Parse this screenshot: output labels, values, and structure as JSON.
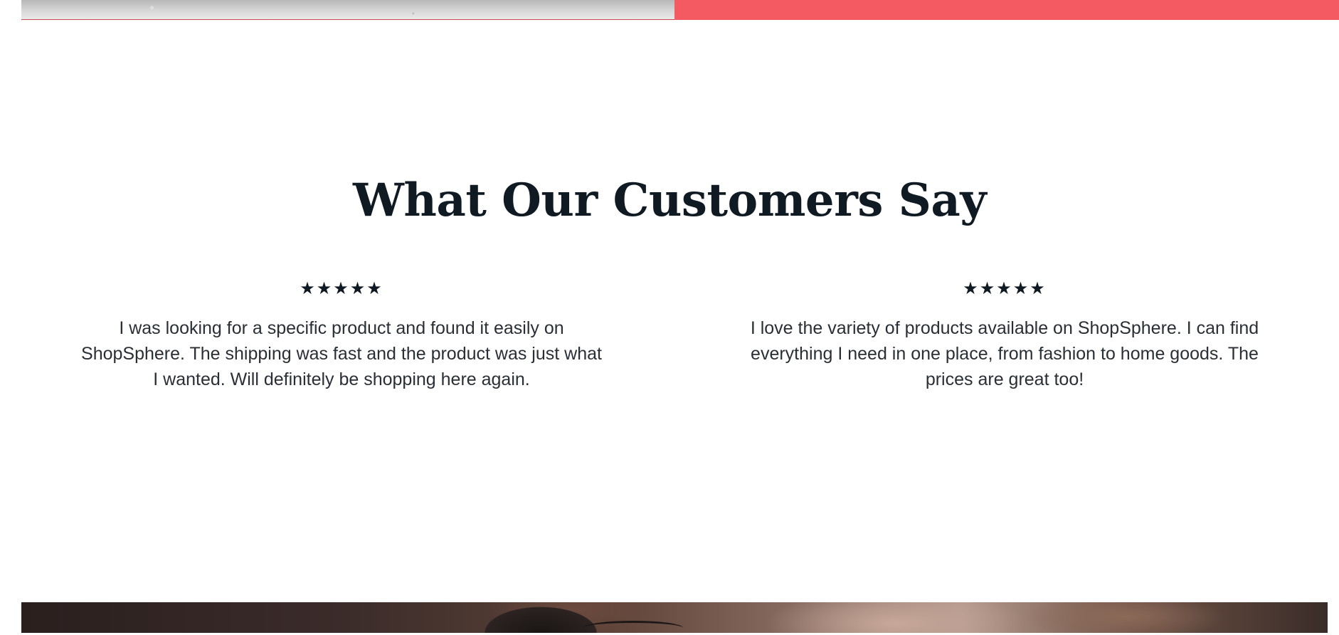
{
  "testimonials": {
    "title": "What Our Customers Say",
    "reviews": [
      {
        "rating": 5,
        "stars": "★★★★★",
        "text": "I was looking for a specific product and found it easily on ShopSphere. The shipping was fast and the product was just what I wanted. Will definitely be shopping here again."
      },
      {
        "rating": 5,
        "stars": "★★★★★",
        "text": "I love the variety of products available on ShopSphere. I can find everything I need in one place, from fashion to home goods. The prices are great too!"
      }
    ]
  },
  "colors": {
    "accent": "#f45a62",
    "title": "#101a23",
    "body_text": "#2a2f35"
  }
}
